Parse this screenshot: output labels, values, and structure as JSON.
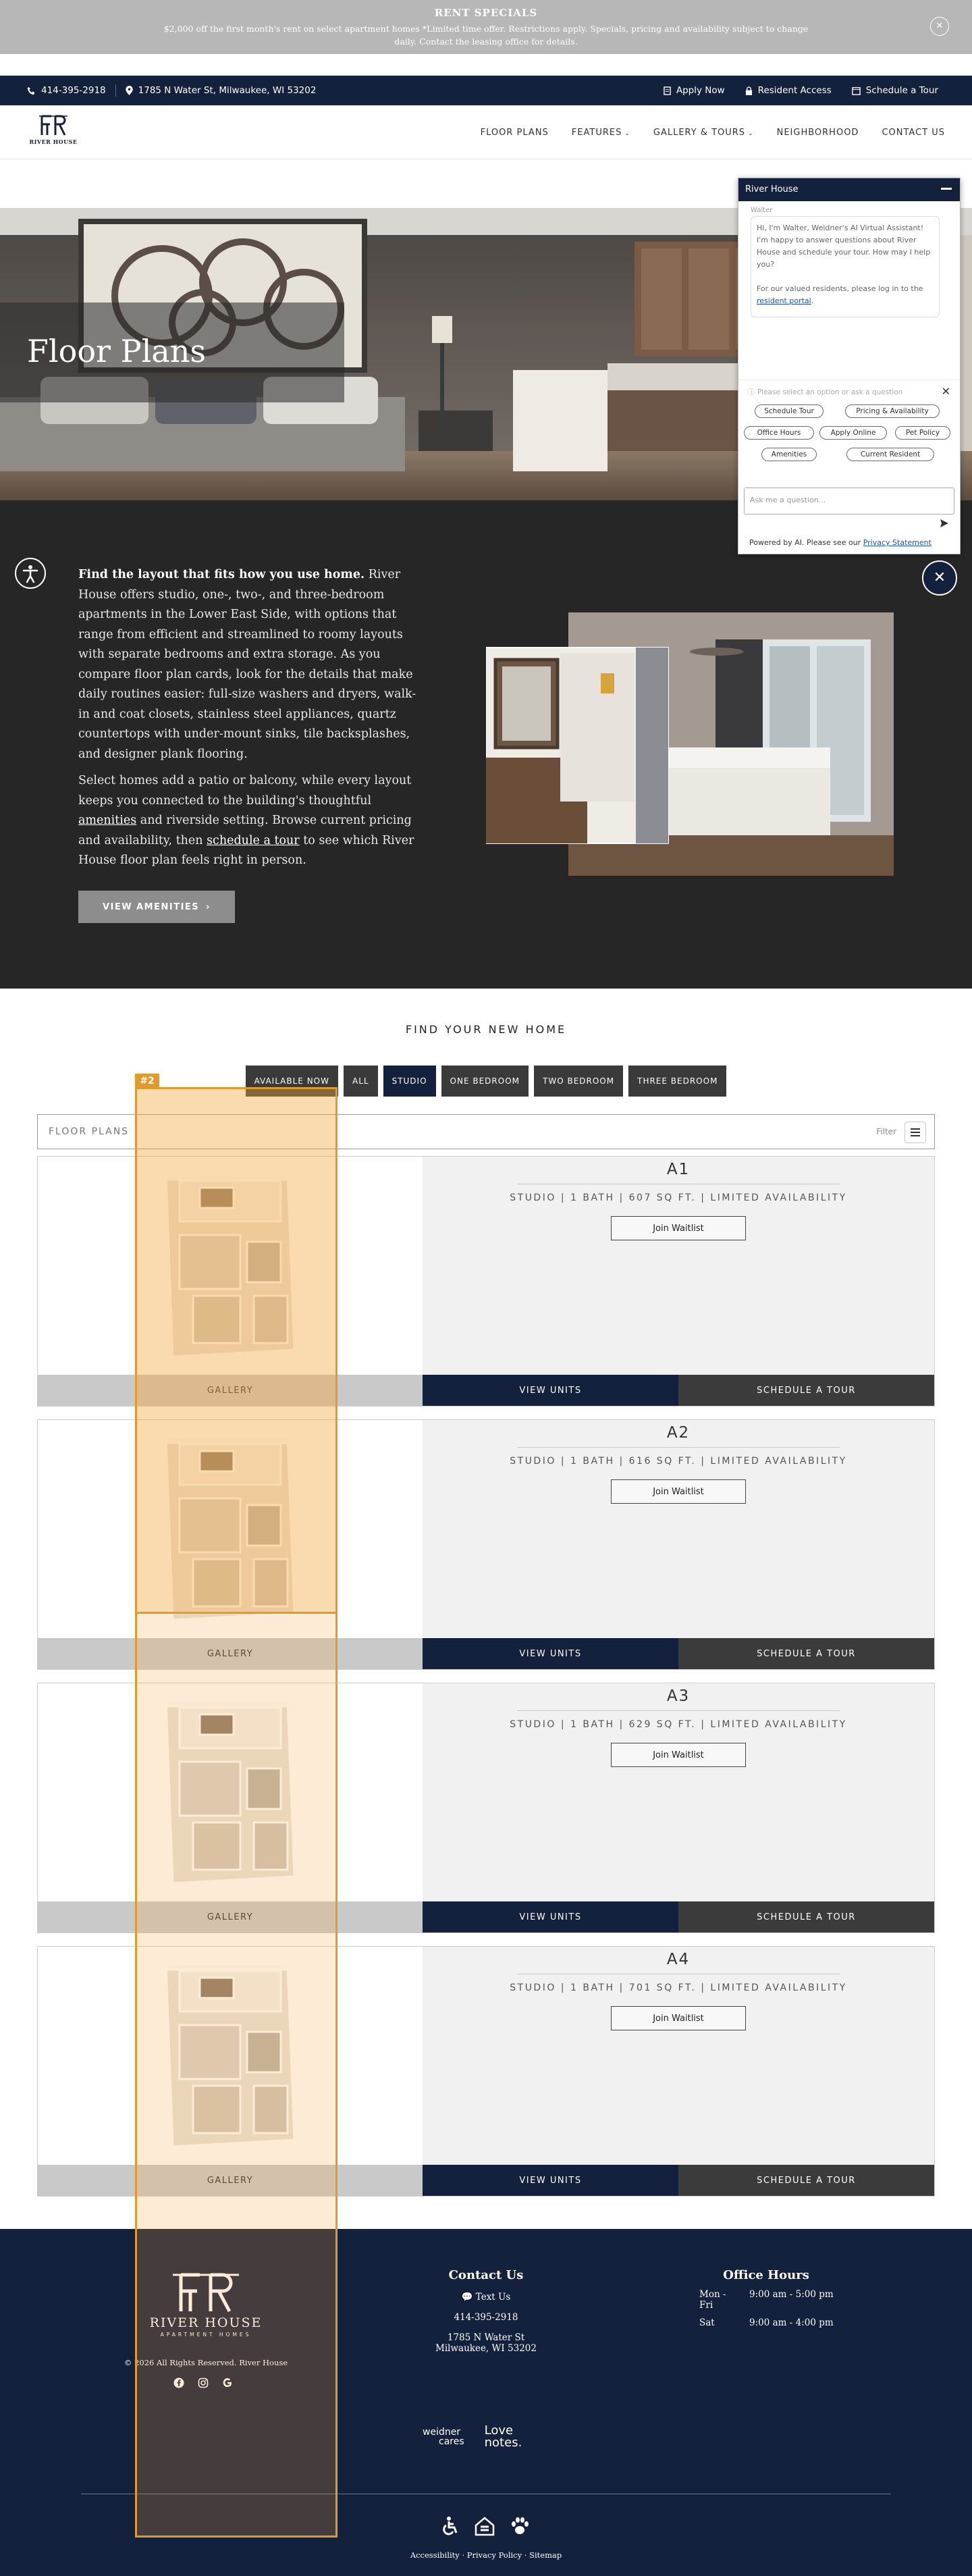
{
  "promo": {
    "title": "RENT SPECIALS",
    "text": "$2,000 off the first month's rent on select apartment homes *Limited time offer. Restrictions apply. Specials, pricing and availability subject to change daily. Contact the leasing office for details.",
    "close": "✕"
  },
  "utility": {
    "phone": "414-395-2918",
    "address": "1785 N Water St, Milwaukee, WI 53202",
    "apply": "Apply Now",
    "resident": "Resident Access",
    "schedule": "Schedule a Tour"
  },
  "nav": {
    "logo_tag": "RIVER HOUSE",
    "items": [
      "FLOOR PLANS",
      "FEATURES",
      "GALLERY & TOURS",
      "NEIGHBORHOOD",
      "CONTACT US"
    ]
  },
  "hero": {
    "title": "Floor Plans"
  },
  "intro": {
    "p1_bold": "Find the layout that fits how you use home.",
    "p1_rest": " River House offers studio, one-, two-, and three-bedroom apartments in the Lower East Side, with options that range from efficient and streamlined to roomy layouts with separate bedrooms and extra storage. As you compare floor plan cards, look for the details that make daily routines easier: full-size washers and dryers, walk-in and coat closets, stainless steel appliances, quartz countertops with under-mount sinks, tile backsplashes, and designer plank flooring.",
    "p2_a": "Select homes add a patio or balcony, while every layout keeps you connected to the building's thoughtful ",
    "p2_link1": "amenities",
    "p2_b": " and riverside setting. Browse current pricing and availability, then ",
    "p2_link2": "schedule a tour",
    "p2_c": " to see which River House floor plan feels right in person.",
    "button": "VIEW AMENITIES",
    "button_arrow": "›"
  },
  "find": {
    "title": "FIND YOUR NEW HOME",
    "filters": [
      "AVAILABLE NOW",
      "ALL",
      "STUDIO",
      "ONE BEDROOM",
      "TWO BEDROOM",
      "THREE BEDROOM"
    ],
    "active_filter": "STUDIO",
    "bar_label": "FLOOR PLANS",
    "filter_label": "Filter"
  },
  "plans": [
    {
      "name": "A1",
      "meta": "STUDIO | 1 BATH | 607 SQ FT. | LIMITED AVAILABILITY",
      "waitlist": "Join Waitlist",
      "gallery": "GALLERY",
      "view": "VIEW UNITS",
      "tour": "SCHEDULE A TOUR"
    },
    {
      "name": "A2",
      "meta": "STUDIO | 1 BATH | 616 SQ FT. | LIMITED AVAILABILITY",
      "waitlist": "Join Waitlist",
      "gallery": "GALLERY",
      "view": "VIEW UNITS",
      "tour": "SCHEDULE A TOUR"
    },
    {
      "name": "A3",
      "meta": "STUDIO | 1 BATH | 629 SQ FT. | LIMITED AVAILABILITY",
      "waitlist": "Join Waitlist",
      "gallery": "GALLERY",
      "view": "VIEW UNITS",
      "tour": "SCHEDULE A TOUR"
    },
    {
      "name": "A4",
      "meta": "STUDIO | 1 BATH | 701 SQ FT. | LIMITED AVAILABILITY",
      "waitlist": "Join Waitlist",
      "gallery": "GALLERY",
      "view": "VIEW UNITS",
      "tour": "SCHEDULE A TOUR"
    }
  ],
  "footer": {
    "brand": "RIVER HOUSE",
    "brand_sub": "APARTMENT HOMES",
    "copyright": "© 2026 All Rights Reserved. River House",
    "contact_title": "Contact Us",
    "text_us": "Text Us",
    "phone": "414-395-2918",
    "address1": "1785 N Water St",
    "address2": "Milwaukee, WI 53202",
    "hours_title": "Office Hours",
    "hours": [
      {
        "day": "Mon - Fri",
        "time": "9:00 am - 5:00 pm"
      },
      {
        "day": "Sat",
        "time": "9:00 am - 4:00 pm"
      }
    ],
    "partner1_a": "weidner",
    "partner1_b": "cares",
    "partner2_a": "Love",
    "partner2_b": "notes.",
    "links": "Accessibility · Privacy Policy · Sitemap"
  },
  "chat": {
    "title": "River House",
    "from": "Walter",
    "message": "Hi, I'm Walter, Weidner's AI Virtual Assistant! I'm happy to answer questions about River House and schedule your tour. How may I help you?",
    "message2": "For our valued residents, please log in to the",
    "message_link": "resident portal",
    "hint": "Please select an option or ask a question",
    "options": [
      "Schedule Tour",
      "Pricing & Availability",
      "Office Hours",
      "Apply Online",
      "Pet Policy",
      "Amenities",
      "Current Resident"
    ],
    "placeholder": "Ask me a question...",
    "powered": "Powered by AI. Please see our ",
    "powered_link": "Privacy Statement"
  },
  "annotation": {
    "label": "#2",
    "color": "#e39a2d"
  }
}
